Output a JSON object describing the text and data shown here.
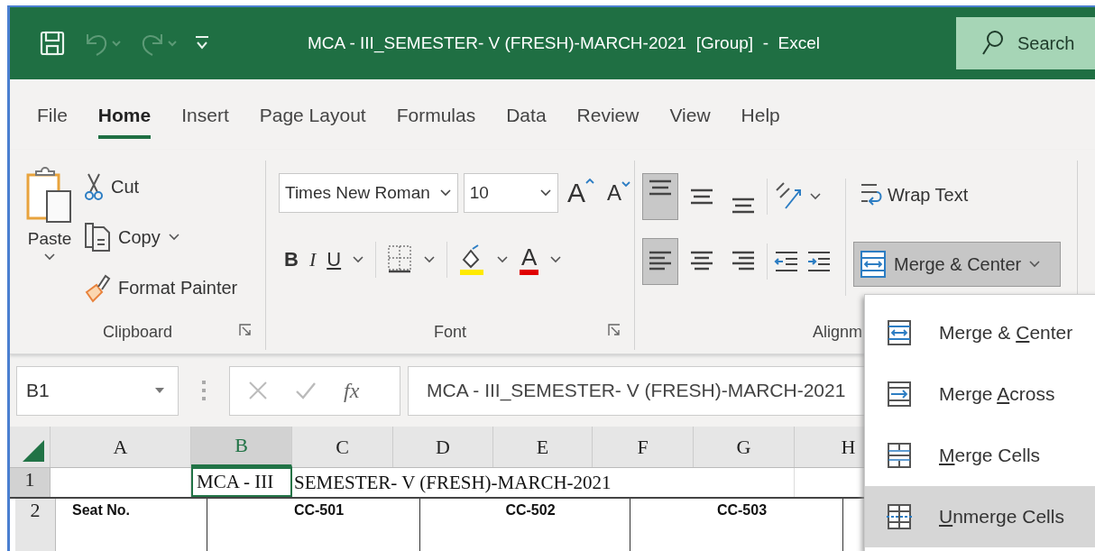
{
  "window": {
    "title": "MCA - III_SEMESTER- V (FRESH)-MARCH-2021  [Group]  -  Excel"
  },
  "quick_access": [
    {
      "kind": "save",
      "disabled": false
    },
    {
      "kind": "undo",
      "disabled": true
    },
    {
      "kind": "redo",
      "disabled": true
    },
    {
      "kind": "customize",
      "disabled": false
    }
  ],
  "search": {
    "placeholder": "Search"
  },
  "tabs": [
    {
      "label": "File",
      "selected": false
    },
    {
      "label": "Home",
      "selected": true
    },
    {
      "label": "Insert",
      "selected": false
    },
    {
      "label": "Page Layout",
      "selected": false
    },
    {
      "label": "Formulas",
      "selected": false
    },
    {
      "label": "Data",
      "selected": false
    },
    {
      "label": "Review",
      "selected": false
    },
    {
      "label": "View",
      "selected": false
    },
    {
      "label": "Help",
      "selected": false
    }
  ],
  "ribbon": {
    "clipboard": {
      "label": "Clipboard",
      "paste": "Paste",
      "cut": "Cut",
      "copy": "Copy",
      "format_painter": "Format Painter"
    },
    "font": {
      "label": "Font",
      "font_name": "Times New Roman",
      "font_size": "10",
      "grow": "A",
      "shrink": "A",
      "bold": "B",
      "italic": "I",
      "underline": "U",
      "font_color": "A"
    },
    "alignment": {
      "label": "Alignm",
      "vertical": [
        {
          "kind": "top",
          "selected": true
        },
        {
          "kind": "middle",
          "selected": false
        },
        {
          "kind": "bottom",
          "selected": false
        }
      ],
      "horizontal": [
        {
          "kind": "left",
          "selected": true
        },
        {
          "kind": "center",
          "selected": false
        },
        {
          "kind": "right",
          "selected": false
        }
      ],
      "wrap_text": "Wrap Text",
      "merge": {
        "label": "Merge & Center",
        "open": true
      }
    }
  },
  "merge_menu": [
    {
      "kind": "center",
      "before": "Merge & ",
      "mnemonic": "C",
      "after": "enter",
      "selected": false
    },
    {
      "kind": "across",
      "before": "Merge ",
      "mnemonic": "A",
      "after": "cross",
      "selected": false
    },
    {
      "kind": "cells",
      "mnemonic": "M",
      "after": "erge Cells",
      "selected": false
    },
    {
      "kind": "unmerge",
      "mnemonic": "U",
      "after": "nmerge Cells",
      "selected": true
    }
  ],
  "formula_bar": {
    "name_box": "B1",
    "function_label": "fx",
    "value": "MCA - III_SEMESTER- V (FRESH)-MARCH-2021"
  },
  "sheet": {
    "columns": [
      {
        "label": "A",
        "selected": false
      },
      {
        "label": "B",
        "selected": true
      },
      {
        "label": "C",
        "selected": false
      },
      {
        "label": "D",
        "selected": false
      },
      {
        "label": "E",
        "selected": false
      },
      {
        "label": "F",
        "selected": false
      },
      {
        "label": "G",
        "selected": false
      },
      {
        "label": "H",
        "selected": false
      }
    ],
    "rows": [
      {
        "header": "1",
        "selected": true,
        "kind": "title",
        "active_cell_text": "MCA - III",
        "overflow_text": "SEMESTER- V (FRESH)-MARCH-2021"
      },
      {
        "header": "2",
        "selected": false,
        "kind": "headings",
        "first": "Seat No.",
        "groups": [
          "CC-501",
          "CC-502",
          "CC-503"
        ]
      }
    ]
  }
}
